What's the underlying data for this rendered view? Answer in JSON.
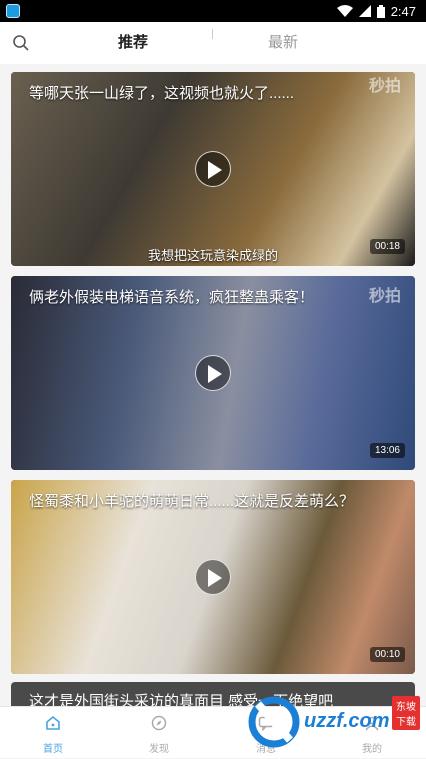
{
  "status": {
    "time": "2:47"
  },
  "tabs": [
    {
      "label": "推荐",
      "active": true
    },
    {
      "label": "最新",
      "active": false
    }
  ],
  "feed": [
    {
      "title": "等哪天张一山绿了，这视频也就火了......",
      "duration": "00:18",
      "watermark": "秒拍",
      "subtitle": "我想把这玩意染成绿的"
    },
    {
      "title": "俩老外假装电梯语音系统，疯狂整蛊乘客！",
      "duration": "13:06",
      "watermark": "秒拍",
      "subtitle": ""
    },
    {
      "title": "怪蜀黍和小羊驼的萌萌日常......这就是反差萌么？",
      "duration": "00:10",
      "watermark": "",
      "subtitle": ""
    },
    {
      "title": "这才是外国街头采访的真面目 感受一下绝望吧"
    }
  ],
  "bottom_nav": [
    {
      "label": "首页",
      "icon": "home-icon",
      "active": true
    },
    {
      "label": "发现",
      "icon": "compass-icon",
      "active": false
    },
    {
      "label": "消息",
      "icon": "message-icon",
      "active": false
    },
    {
      "label": "我的",
      "icon": "profile-icon",
      "active": false
    }
  ],
  "overlay_logo": {
    "text": "uzzf.com",
    "badge": "东坡下载"
  },
  "colors": {
    "accent": "#4aa3e0",
    "status_bar": "#000000"
  }
}
